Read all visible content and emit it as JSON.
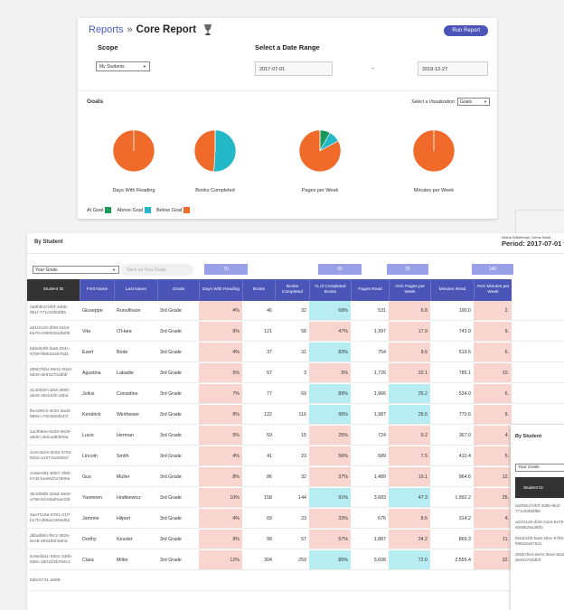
{
  "header": {
    "breadcrumb_link": "Reports",
    "breadcrumb_sep": "»",
    "breadcrumb_current": "Core Report",
    "run_button": "Run Report"
  },
  "scope": {
    "label": "Scope",
    "value": "My Students"
  },
  "date_range": {
    "label": "Select a Date Range",
    "start": "2017-07-01",
    "dash": "–",
    "end": "2018-12-27"
  },
  "goals": {
    "title": "Goals",
    "viz_label": "Select a Visualization:",
    "viz_value": "Goals",
    "charts": [
      {
        "label": "Days With Reading",
        "at_goal": 0,
        "above_goal": 0,
        "below_goal": 100
      },
      {
        "label": "Books Completed",
        "at_goal": 0,
        "above_goal": 51,
        "below_goal": 49
      },
      {
        "label": "Pages per Week",
        "at_goal": 8,
        "above_goal": 9,
        "below_goal": 83
      },
      {
        "label": "Minutes per Week",
        "at_goal": 0,
        "above_goal": 0,
        "below_goal": 100
      }
    ],
    "legend": [
      {
        "label": "At Goal",
        "color": "#1a9a5a"
      },
      {
        "label": "Above Goal",
        "color": "#22b8c8"
      },
      {
        "label": "Below Goal",
        "color": "#f06a2a"
      }
    ]
  },
  "by_student": {
    "title": "By Student",
    "user_line": "Alisha Wilderman, Demo Build",
    "period": "Period: 2017-07-01 t",
    "goal_select": "Your Goals",
    "save_label": "Save as Your Goals",
    "goal_values": [
      "70",
      "60",
      "25",
      "140"
    ],
    "columns": [
      "Student ID",
      "First Name",
      "Last Name",
      "Grade",
      "Days With Reading",
      "Books",
      "Books Completed",
      "% of Completed Books",
      "Pages Read",
      "AVG Pages per Week",
      "Minutes Read",
      "AVG Minutes per Week"
    ],
    "rows": [
      {
        "id": "0a9f3b1f-bf0f-3d9b-9b1f-771c83f8df85",
        "first": "Giuseppe",
        "last": "Runolfsson",
        "grade": "3rd Grade",
        "days": "4%",
        "books": "46",
        "completed": "32",
        "pct": "69%",
        "pages": "531",
        "avg_pages": "6.8",
        "minutes": "190.0",
        "avg_min": "2."
      },
      {
        "id": "ad1f2120-df49-3104-8a79-e068526a380b",
        "first": "Vita",
        "last": "O'Hara",
        "grade": "3rd Grade",
        "days": "9%",
        "books": "121",
        "completed": "58",
        "pct": "47%",
        "pages": "1,397",
        "avg_pages": "17.9",
        "minutes": "743.9",
        "avg_min": "9."
      },
      {
        "id": "bb6dd4f8-faa8-384c-97b8-f88522a575d1",
        "first": "Evert",
        "last": "Bode",
        "grade": "3rd Grade",
        "days": "4%",
        "books": "37",
        "completed": "31",
        "pct": "83%",
        "pages": "754",
        "avg_pages": "9.6",
        "minutes": "519.5",
        "avg_min": "6."
      },
      {
        "id": "d05b7bb4-8e04-30a2-9d40-de94270ddfdf",
        "first": "Agustina",
        "last": "Labadie",
        "grade": "3rd Grade",
        "days": "5%",
        "books": "57",
        "completed": "3",
        "pct": "5%",
        "pages": "1,726",
        "avg_pages": "22.1",
        "minutes": "785.1",
        "avg_min": "10."
      },
      {
        "id": "d140fd4f-cd93-3800-abe5-39cb32fc16bd",
        "first": "Julius",
        "last": "Considine",
        "grade": "3rd Grade",
        "days": "7%",
        "books": "77",
        "completed": "69",
        "pct": "89%",
        "pages": "1,966",
        "avg_pages": "25.2",
        "minutes": "534.0",
        "avg_min": "6."
      },
      {
        "id": "fbe199c3-4e30-3ad4-9884-c78c582d537f",
        "first": "Kendrick",
        "last": "Wintheiser",
        "grade": "3rd Grade",
        "days": "8%",
        "books": "122",
        "completed": "116",
        "pct": "95%",
        "pages": "1,987",
        "avg_pages": "25.5",
        "minutes": "770.6",
        "avg_min": "9."
      },
      {
        "id": "1acfb90a-8339-3626-a8d2-c8dcad5fd09a",
        "first": "Lucio",
        "last": "Herman",
        "grade": "3rd Grade",
        "days": "5%",
        "books": "59",
        "completed": "15",
        "pct": "25%",
        "pages": "724",
        "avg_pages": "9.2",
        "minutes": "367.0",
        "avg_min": "4."
      },
      {
        "id": "2c8c3eb3-d025-3784-91b2-a10731e536cf",
        "first": "Lincoln",
        "last": "Smith",
        "grade": "3rd Grade",
        "days": "4%",
        "books": "41",
        "completed": "23",
        "pct": "56%",
        "pages": "589",
        "avg_pages": "7.5",
        "minutes": "410.4",
        "avg_min": "5."
      },
      {
        "id": "2c8ee391-80b7-3f80-b7d2-bea9d7a7605a",
        "first": "Gus",
        "last": "Muller",
        "grade": "3rd Grade",
        "days": "8%",
        "books": "86",
        "completed": "32",
        "pct": "37%",
        "pages": "1,489",
        "avg_pages": "19.1",
        "minutes": "964.6",
        "avg_min": "12."
      },
      {
        "id": "3b4d06f8-1b9d-360e-a759-54195d0ae428",
        "first": "Yasmeen",
        "last": "Hodkiewicz",
        "grade": "3rd Grade",
        "days": "10%",
        "books": "158",
        "completed": "144",
        "pct": "91%",
        "pages": "3,683",
        "avg_pages": "47.3",
        "minutes": "1,992.2",
        "avg_min": "25."
      },
      {
        "id": "4ae7019d-6781-31f7-b17b-d68a41994d62",
        "first": "Jammie",
        "last": "Hilpert",
        "grade": "3rd Grade",
        "days": "4%",
        "books": "69",
        "completed": "23",
        "pct": "33%",
        "pages": "676",
        "avg_pages": "8.6",
        "minutes": "314.2",
        "avg_min": "4."
      },
      {
        "id": "dbbaf894-f9c2-3825-8ce8-4834bbf4a04c",
        "first": "Dorthy",
        "last": "Kessler",
        "grade": "3rd Grade",
        "days": "9%",
        "books": "99",
        "completed": "57",
        "pct": "57%",
        "pages": "1,887",
        "avg_pages": "24.2",
        "minutes": "869.3",
        "avg_min": "11."
      },
      {
        "id": "5c8ed841-5601-338b-8d6c-16011f2b762c1",
        "first": "Ciara",
        "last": "Miller",
        "grade": "3rd Grade",
        "days": "12%",
        "books": "304",
        "completed": "259",
        "pct": "85%",
        "pages": "5,608",
        "avg_pages": "72.0",
        "minutes": "2,555.4",
        "avg_min": "32."
      },
      {
        "id": "6dbcb741-a589-",
        "first": "",
        "last": "",
        "grade": "",
        "days": "",
        "books": "",
        "completed": "",
        "pct": "",
        "pages": "",
        "avg_pages": "",
        "minutes": "",
        "avg_min": ""
      }
    ]
  },
  "overlay": {
    "title": "By Student",
    "select": "Your Goals",
    "col": "Student ID",
    "ids": [
      "0a9f3b1f-bf0f-3d9b-9b1f-771c83f8df85",
      "ad1f2120-df49-3104-8a79-e068526a380b",
      "bb6dd4f8-faa8-384c-97b8-f88522a575d1",
      "d05b7bb4-8e04-30a2-9d40-de94270ddfdf"
    ]
  },
  "colors": {
    "accent": "#4b55b8",
    "pink": "#f9d5cf",
    "blue": "#b7ecf2",
    "below_goal": "#f06a2a"
  }
}
